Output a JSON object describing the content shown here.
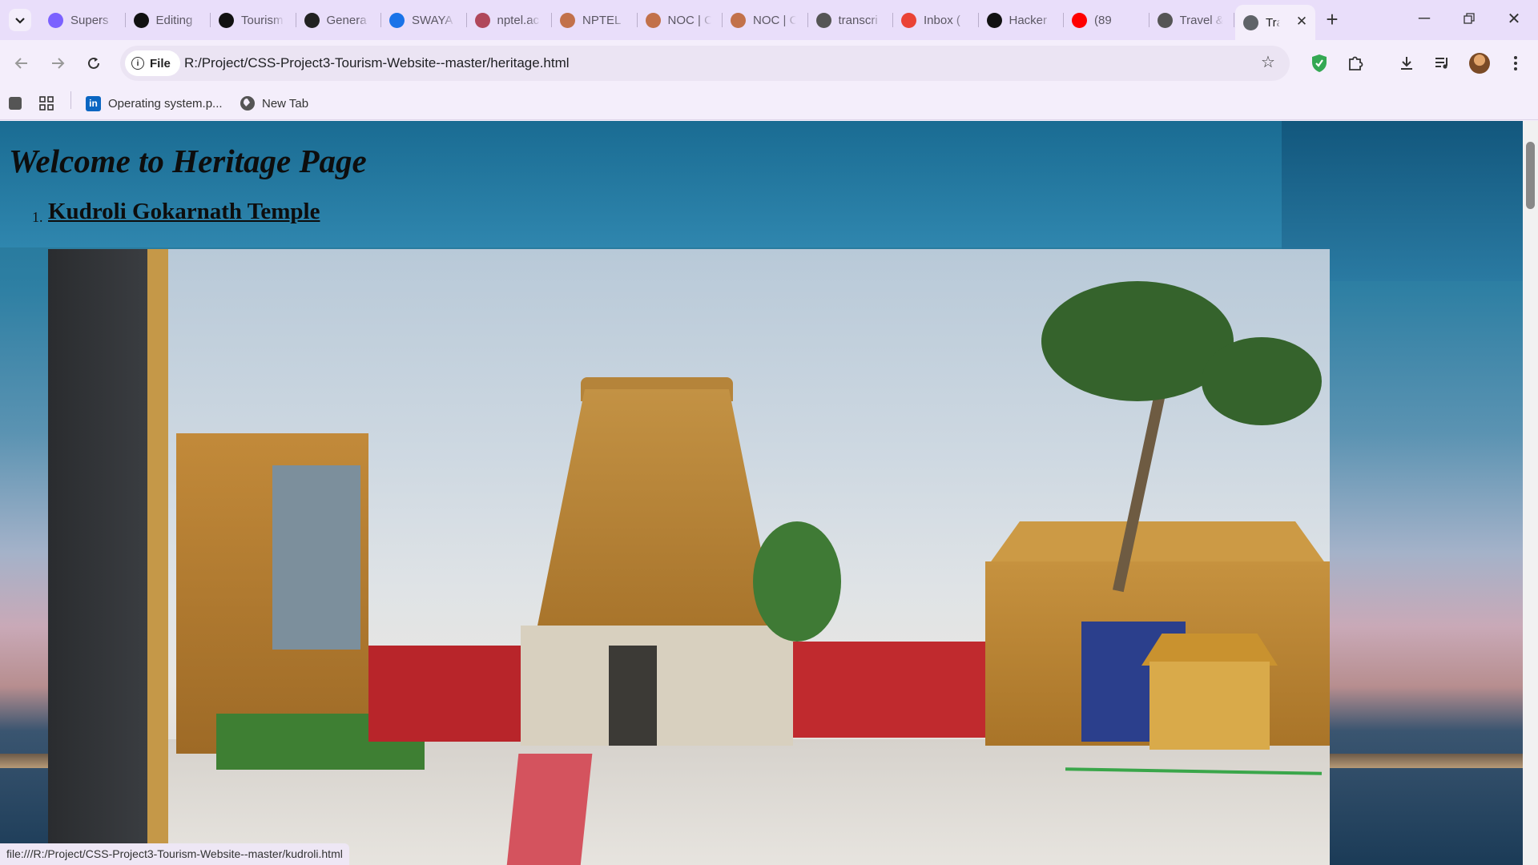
{
  "browser": {
    "tabs": [
      {
        "title": "Supers",
        "favicon": "ai-icon",
        "color": "#7b61ff"
      },
      {
        "title": "Editing",
        "favicon": "github-icon",
        "color": "#111111"
      },
      {
        "title": "Tourism",
        "favicon": "github-icon",
        "color": "#111111"
      },
      {
        "title": "Genera",
        "favicon": "openai-icon",
        "color": "#222222"
      },
      {
        "title": "SWAYA",
        "favicon": "swayam-icon",
        "color": "#1a73e8"
      },
      {
        "title": "nptel.ac",
        "favicon": "nptel-icon",
        "color": "#b0485b"
      },
      {
        "title": "NPTEL",
        "favicon": "nptel-icon",
        "color": "#c2714a"
      },
      {
        "title": "NOC | C",
        "favicon": "nptel-icon",
        "color": "#c2714a"
      },
      {
        "title": "NOC | C",
        "favicon": "nptel-icon",
        "color": "#c2714a"
      },
      {
        "title": "transcri",
        "favicon": "globe-icon",
        "color": "#555555"
      },
      {
        "title": "Inbox (",
        "favicon": "gmail-icon",
        "color": "#ea4335"
      },
      {
        "title": "Hacker",
        "favicon": "hackerrank-icon",
        "color": "#111111"
      },
      {
        "title": "(89",
        "favicon": "youtube-icon",
        "color": "#ff0000"
      },
      {
        "title": "Travel &",
        "favicon": "globe-icon",
        "color": "#555555"
      }
    ],
    "active_tab": {
      "title": "Tra",
      "favicon": "globe-icon"
    },
    "address": {
      "scheme_label": "File",
      "url": "R:/Project/CSS-Project3-Tourism-Website--master/heritage.html"
    },
    "bookmarks": [
      {
        "label": "Operating system.p...",
        "icon": "linkedin-icon"
      },
      {
        "label": "New Tab",
        "icon": "globe-icon"
      }
    ],
    "status_url": "file:///R:/Project/CSS-Project3-Tourism-Website--master/kudroli.html"
  },
  "page": {
    "heading": "Welcome to Heritage Page",
    "list": [
      {
        "number": "1.",
        "label": "Kudroli Gokarnath Temple"
      }
    ]
  },
  "colors": {
    "tabstrip": "#e9defa",
    "toolbar": "#f4eefb",
    "omnibox": "#ebe4f3"
  }
}
